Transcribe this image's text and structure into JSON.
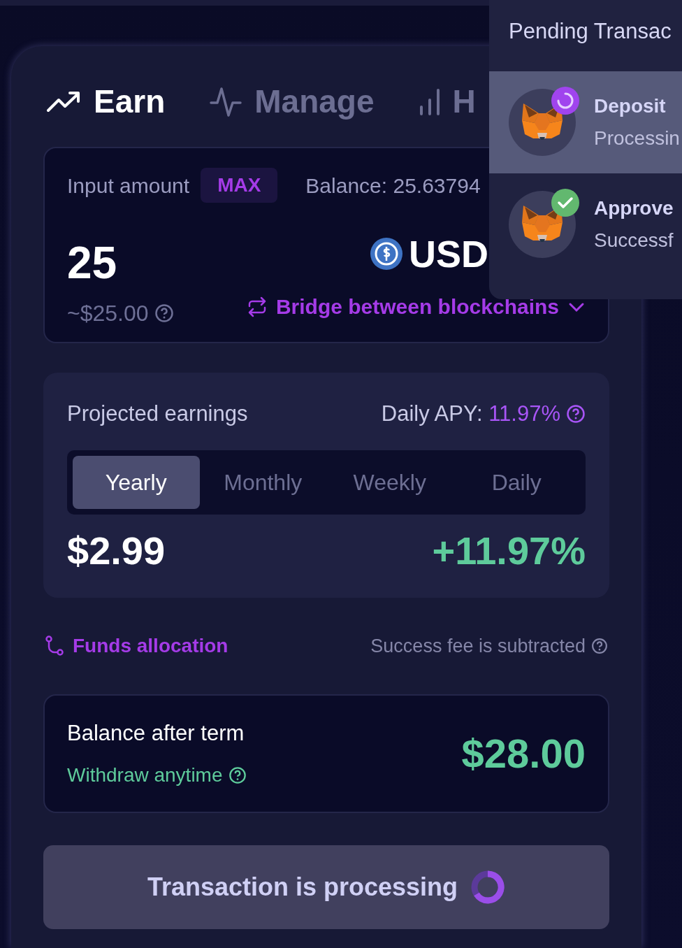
{
  "tabs": [
    {
      "label": "Earn",
      "kind": "trend",
      "selected": true
    },
    {
      "label": "Manage",
      "kind": "pulse",
      "selected": false
    },
    {
      "label": "H",
      "kind": "bars",
      "selected": false
    }
  ],
  "input": {
    "label": "Input amount",
    "max_button": "MAX",
    "balance": "Balance: 25.63794",
    "amount": "25",
    "usd_value": "~$25.00",
    "token": "USD",
    "bridge_link": "Bridge between blockchains"
  },
  "projected": {
    "title": "Projected earnings",
    "apy_label": "Daily APY:",
    "apy_value": "11.97%",
    "periods": [
      {
        "label": "Yearly",
        "selected": true
      },
      {
        "label": "Monthly",
        "selected": false
      },
      {
        "label": "Weekly",
        "selected": false
      },
      {
        "label": "Daily",
        "selected": false
      }
    ],
    "earnings": "$2.99",
    "change": "+11.97%"
  },
  "funds_link": "Funds allocation",
  "fee_note": "Success fee is subtracted",
  "balance_after": {
    "label": "Balance after term",
    "withdraw": "Withdraw anytime",
    "value": "$28.00"
  },
  "submit_button": "Transaction is processing",
  "pending": {
    "title": "Pending Transac",
    "items": [
      {
        "title": "Deposit",
        "status_text": "Processin",
        "kind": "processing",
        "selected": true
      },
      {
        "title": "Approve",
        "status_text": "Successf",
        "kind": "success",
        "selected": false
      }
    ]
  }
}
